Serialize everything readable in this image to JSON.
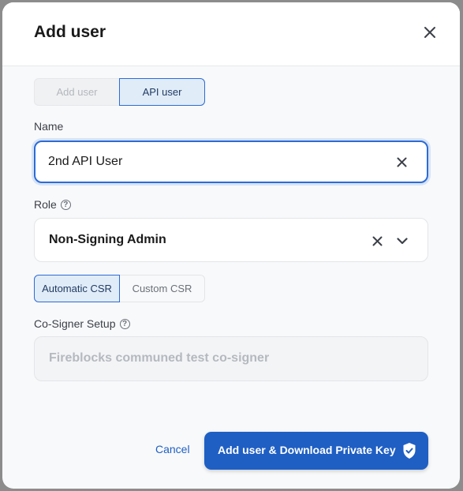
{
  "dialog": {
    "title": "Add user"
  },
  "user_type_toggle": {
    "options": [
      "Add user",
      "API user"
    ],
    "selected": "API user"
  },
  "name_field": {
    "label": "Name",
    "value": "2nd API User"
  },
  "role_field": {
    "label": "Role",
    "value": "Non-Signing Admin"
  },
  "csr_toggle": {
    "options": [
      "Automatic CSR",
      "Custom CSR"
    ],
    "selected": "Automatic CSR"
  },
  "cosigner_field": {
    "label": "Co-Signer Setup",
    "value": "Fireblocks communed test co-signer"
  },
  "footer": {
    "cancel_label": "Cancel",
    "submit_label": "Add user & Download Private Key"
  },
  "icons": {
    "close": "close-icon",
    "help": "question-circle-icon",
    "clear": "x-clear-icon",
    "dropdown": "chevron-down-icon",
    "shield": "shield-check-icon"
  },
  "colors": {
    "accent": "#1f5fc4",
    "selected_bg": "#e1ecf9",
    "focus_border": "#2d6bd5"
  }
}
